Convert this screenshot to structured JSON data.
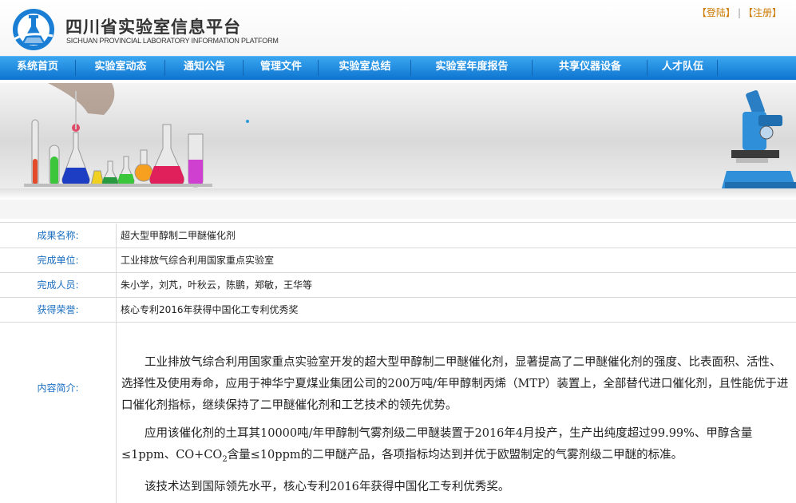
{
  "header": {
    "title_cn": "四川省实验室信息平台",
    "title_en": "SICHUAN PROVINCIAL LABORATORY INFORMATION PLATFORM",
    "login_label": "【登陆】",
    "separator": "|",
    "register_label": "【注册】"
  },
  "nav": {
    "items": [
      {
        "label": "系统首页"
      },
      {
        "label": "实验室动态"
      },
      {
        "label": "通知公告"
      },
      {
        "label": "管理文件"
      },
      {
        "label": "实验室总结"
      },
      {
        "label": "实验室年度报告"
      },
      {
        "label": "共享仪器设备"
      },
      {
        "label": "人才队伍"
      }
    ]
  },
  "colors": {
    "nav_top": "#3aa6f0",
    "nav_bottom": "#0d74cf",
    "label_blue": "#1a6fc0",
    "auth_orange": "#cc7a00"
  },
  "icons": [
    "logo-flask-icon",
    "lab-glassware-icon",
    "microscope-icon"
  ],
  "details": {
    "name_label": "成果名称:",
    "name_value": "超大型甲醇制二甲醚催化剂",
    "unit_label": "完成单位:",
    "unit_value": "工业排放气综合利用国家重点实验室",
    "people_label": "完成人员:",
    "people_value": "朱小学，刘芃，叶秋云，陈鹏，郑敏，王华等",
    "honor_label": "获得荣誉:",
    "honor_value": "核心专利2016年获得中国化工专利优秀奖",
    "content_label": "内容简介:",
    "content_p1": "工业排放气综合利用国家重点实验室开发的超大型甲醇制二甲醚催化剂，显著提高了二甲醚催化剂的强度、比表面积、活性、选择性及使用寿命，应用于神华宁夏煤业集团公司的200万吨/年甲醇制丙烯（MTP）装置上，全部替代进口催化剂，且性能优于进口催化剂指标，继续保持了二甲醚催化剂和工艺技术的领先优势。",
    "content_p2_a": "应用该催化剂的土耳其10000吨/年甲醇制气雾剂级二甲醚装置于2016年4月投产，生产出纯度超过99.99%、甲醇含量≤1ppm、CO+CO",
    "content_p2_sub": "2",
    "content_p2_b": "含量≤10ppm的二甲醚产品，各项指标均达到并优于欧盟制定的气雾剂级二甲醚的标准。",
    "content_p3": "该技术达到国际领先水平，核心专利2016年获得中国化工专利优秀奖。"
  }
}
